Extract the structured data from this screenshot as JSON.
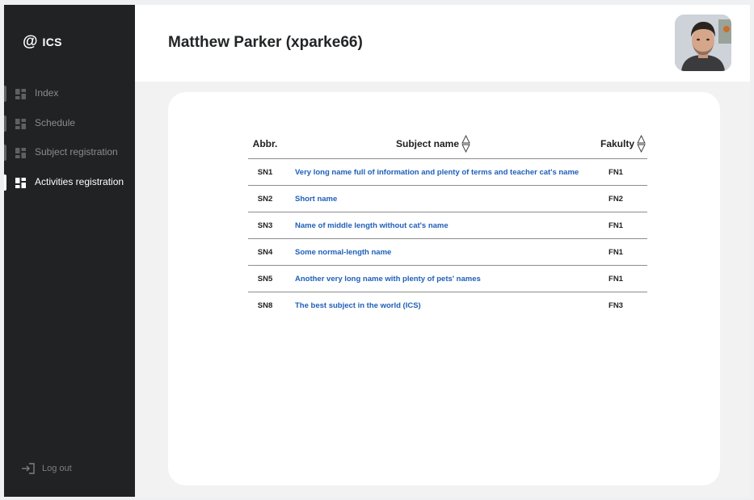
{
  "app": {
    "logo_symbol": "@",
    "logo_text": "ICS"
  },
  "sidebar": {
    "items": [
      {
        "label": "Index",
        "icon": "dashboard-icon",
        "active": false
      },
      {
        "label": "Schedule",
        "icon": "dashboard-icon",
        "active": false
      },
      {
        "label": "Subject registration",
        "icon": "dashboard-icon",
        "active": false
      },
      {
        "label": "Activities registration",
        "icon": "dashboard-icon",
        "active": true
      }
    ],
    "logout_label": "Log out",
    "logout_icon": "logout-icon"
  },
  "header": {
    "title": "Matthew Parker (xparke66)",
    "avatar_icon": "user-avatar"
  },
  "table": {
    "columns": [
      {
        "label": "Abbr.",
        "sortable": false
      },
      {
        "label": "Subject name",
        "sortable": true
      },
      {
        "label": "Fakulty",
        "sortable": true
      }
    ],
    "rows": [
      {
        "abbr": "SN1",
        "name": "Very long name full of information and plenty of terms and teacher cat's name",
        "faculty": "FN1"
      },
      {
        "abbr": "SN2",
        "name": "Short name",
        "faculty": "FN2"
      },
      {
        "abbr": "SN3",
        "name": "Name of middle length without cat's name",
        "faculty": "FN1"
      },
      {
        "abbr": "SN4",
        "name": "Some normal-length name",
        "faculty": "FN1"
      },
      {
        "abbr": "SN5",
        "name": "Another very long name with plenty of pets' names",
        "faculty": "FN1"
      },
      {
        "abbr": "SN8",
        "name": "The best subject in the world (ICS)",
        "faculty": "FN3"
      }
    ]
  },
  "colors": {
    "sidebar_bg": "#212223",
    "content_bg": "#f2f2f2",
    "link": "#1f5fb8",
    "active_text": "#ffffff",
    "inactive_text": "#8a8c90"
  }
}
